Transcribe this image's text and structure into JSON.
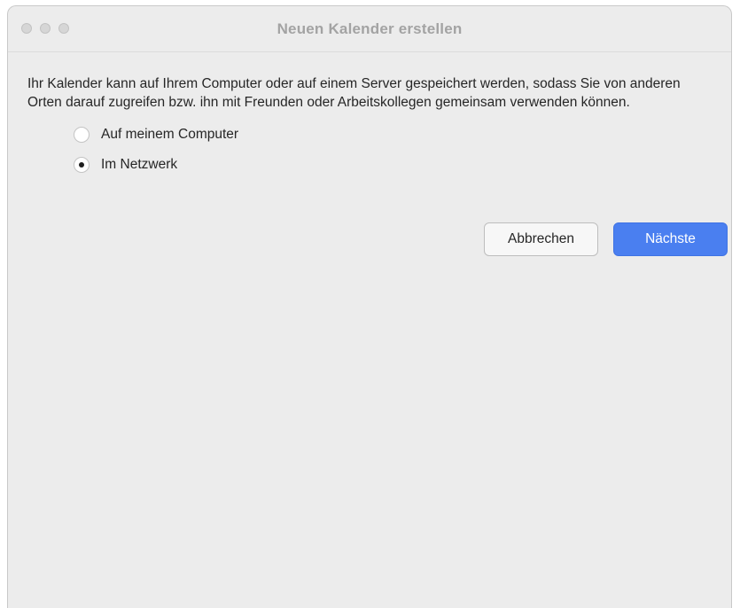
{
  "window": {
    "title": "Neuen Kalender erstellen"
  },
  "dialog": {
    "description": "Ihr Kalender kann auf Ihrem Computer oder auf einem Server gespeichert werden, sodass Sie von anderen Orten darauf zugreifen bzw. ihn mit Freunden oder Arbeitskollegen gemeinsam verwenden können.",
    "options": [
      {
        "label": "Auf meinem Computer",
        "selected": false
      },
      {
        "label": "Im Netzwerk",
        "selected": true
      }
    ],
    "cancel_label": "Abbrechen",
    "next_label": "Nächste"
  },
  "colors": {
    "accent": "#4a7ff0",
    "window_bg": "#ececec"
  }
}
